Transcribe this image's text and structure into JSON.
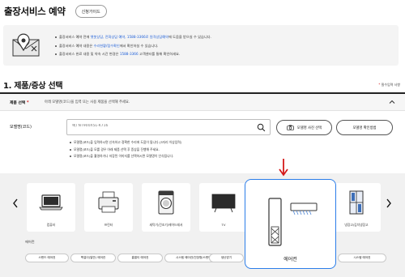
{
  "page": {
    "title": "출장서비스 예약",
    "guide_button": "신청가이드"
  },
  "notice": {
    "line1_a": "출장서비스 예약 전에 ",
    "line1_hl": "챗봇상담, 전화상담 예약, 1588-3366로 원격상담예약",
    "line1_b": "에 도움을 받으실 수 있습니다.",
    "line2_a": "출장서비스 예약 내용은 ",
    "line2_hl": "수리현황/접수확인",
    "line2_b": "에서 확인하실 수 있습니다.",
    "line3_a": "출장서비스 완료 내용 및 약속 시간 변경은 ",
    "line3_hl": "1588-3366",
    "line3_b": " 고객센터를 통해 확인하세요."
  },
  "section": {
    "title": "1. 제품/증상 선택",
    "required_star": "*",
    "required_text": " 필수입력 사항"
  },
  "product_select": {
    "label": "제품 선택",
    "star": "*",
    "description": "아래 모델명(코드)을 입력 또는 사용 제품을 선택해 주세요."
  },
  "model": {
    "label": "모델명(코드)",
    "placeholder": "예) NT900X5L-K716",
    "find_button": "모델명 사진 선택",
    "how_button": "모델명 확인방법",
    "hints": [
      "모델명(코드)을 입력하시면 신속하고 정확한 수리에 도움이 됩니다.(3자리 이상입력)",
      "모델명(코드)을 모를 경우 아래 제품 선택 후 증상을 진행해 주세요.",
      "모델명(코드)을 촬영하거나 저장된 이미지를 선택하시면 모델명이 인식됩니다."
    ]
  },
  "products": {
    "cards": [
      {
        "label": "컴퓨터"
      },
      {
        "label": "프린터"
      },
      {
        "label": "세탁기/건조기/에어드레서"
      },
      {
        "label": "TV"
      },
      {
        "label": "에어컨"
      },
      {
        "label": "냉장고/김치냉장고"
      }
    ],
    "sub_label": "에어컨",
    "chips": [
      "스탠드 에어컨",
      "벽걸이(일반) 에어컨",
      "홈멀티 에어컨",
      "시스템 에어컨(천장형/스탠드/벽걸이)",
      "냉난방기",
      "시스템 에어컨"
    ]
  },
  "colors": {
    "accent": "#2b7de9",
    "highlight": "#1e5fd8",
    "red": "#d51a1a"
  }
}
